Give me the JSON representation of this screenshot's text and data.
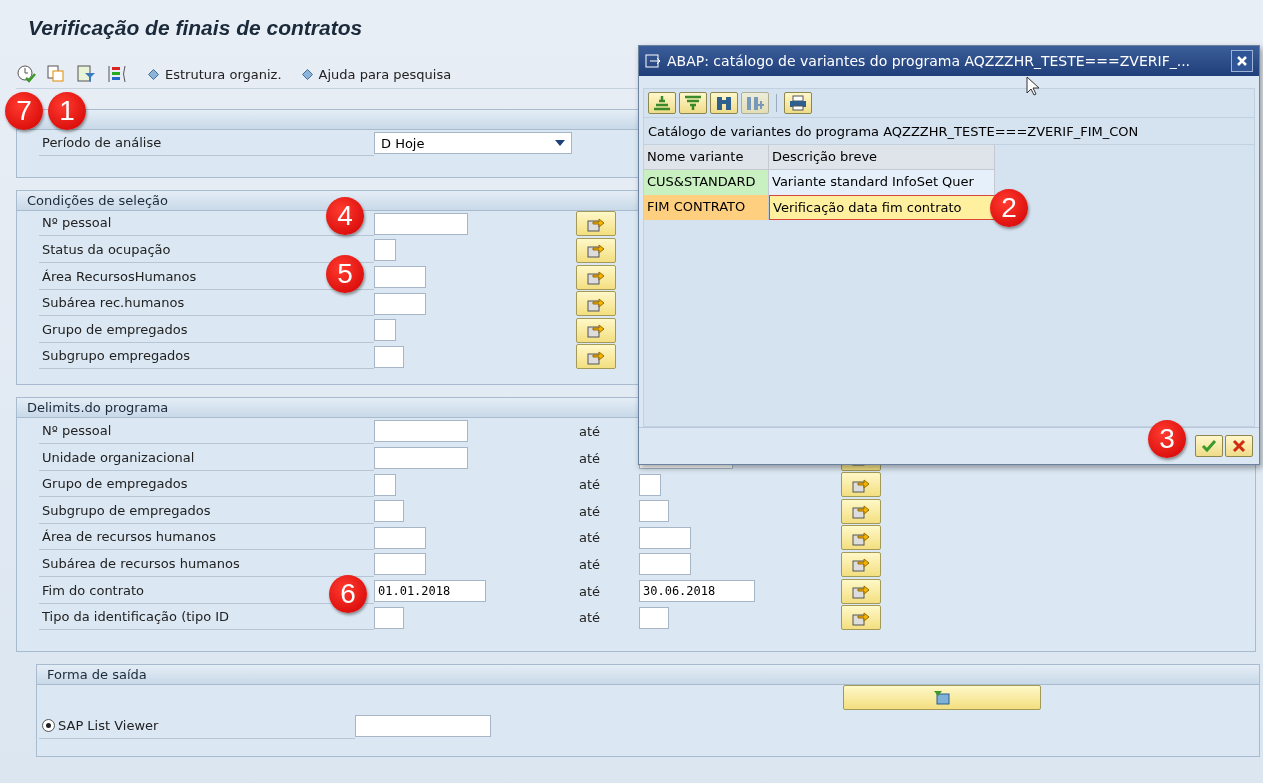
{
  "title": "Verificação de finais de contratos",
  "toolbar_links": [
    "Estrutura organiz.",
    "Ajuda para pesquisa"
  ],
  "period_group": {
    "label": "Período de análise",
    "value": "D Hoje"
  },
  "selection_group": {
    "header": "Condições de seleção",
    "rows": [
      {
        "label": "Nº pessoal"
      },
      {
        "label": "Status da ocupação"
      },
      {
        "label": "Área RecursosHumanos"
      },
      {
        "label": "Subárea rec.humanos"
      },
      {
        "label": "Grupo de empregados"
      },
      {
        "label": "Subgrupo empregados"
      }
    ]
  },
  "program_group": {
    "header": "Delimits.do programa",
    "rows": [
      {
        "label": "Nº pessoal",
        "to_label": "até"
      },
      {
        "label": "Unidade organizacional",
        "to_label": "até"
      },
      {
        "label": "Grupo de empregados",
        "to_label": "até"
      },
      {
        "label": "Subgrupo de empregados",
        "to_label": "até"
      },
      {
        "label": "Área de recursos humanos",
        "to_label": "até"
      },
      {
        "label": "Subárea de recursos humanos",
        "to_label": "até"
      },
      {
        "label": "Fim do contrato",
        "to_label": "até",
        "from": "01.01.2018",
        "to": "30.06.2018"
      },
      {
        "label": "Tipo da identificação (tipo ID",
        "to_label": "até"
      }
    ]
  },
  "output_group": {
    "header": "Forma de saída",
    "option": {
      "label": "SAP List Viewer",
      "selected": true
    }
  },
  "dialog": {
    "title": "ABAP: catálogo de variantes do programa AQZZZHR_TESTE===ZVERIF_...",
    "caption": "Catálogo de variantes do programa AQZZZHR_TESTE===ZVERIF_FIM_CON",
    "columns": [
      "Nome variante",
      "Descrição breve"
    ],
    "rows": [
      {
        "name": "CUS&STANDARD",
        "description": "Variante standard InfoSet Quer",
        "selected": false
      },
      {
        "name": "FIM CONTRATO",
        "description": "Verificação data fim contrato",
        "selected": true
      }
    ]
  },
  "badges": [
    "7",
    "1",
    "2",
    "3",
    "4",
    "5",
    "6"
  ]
}
